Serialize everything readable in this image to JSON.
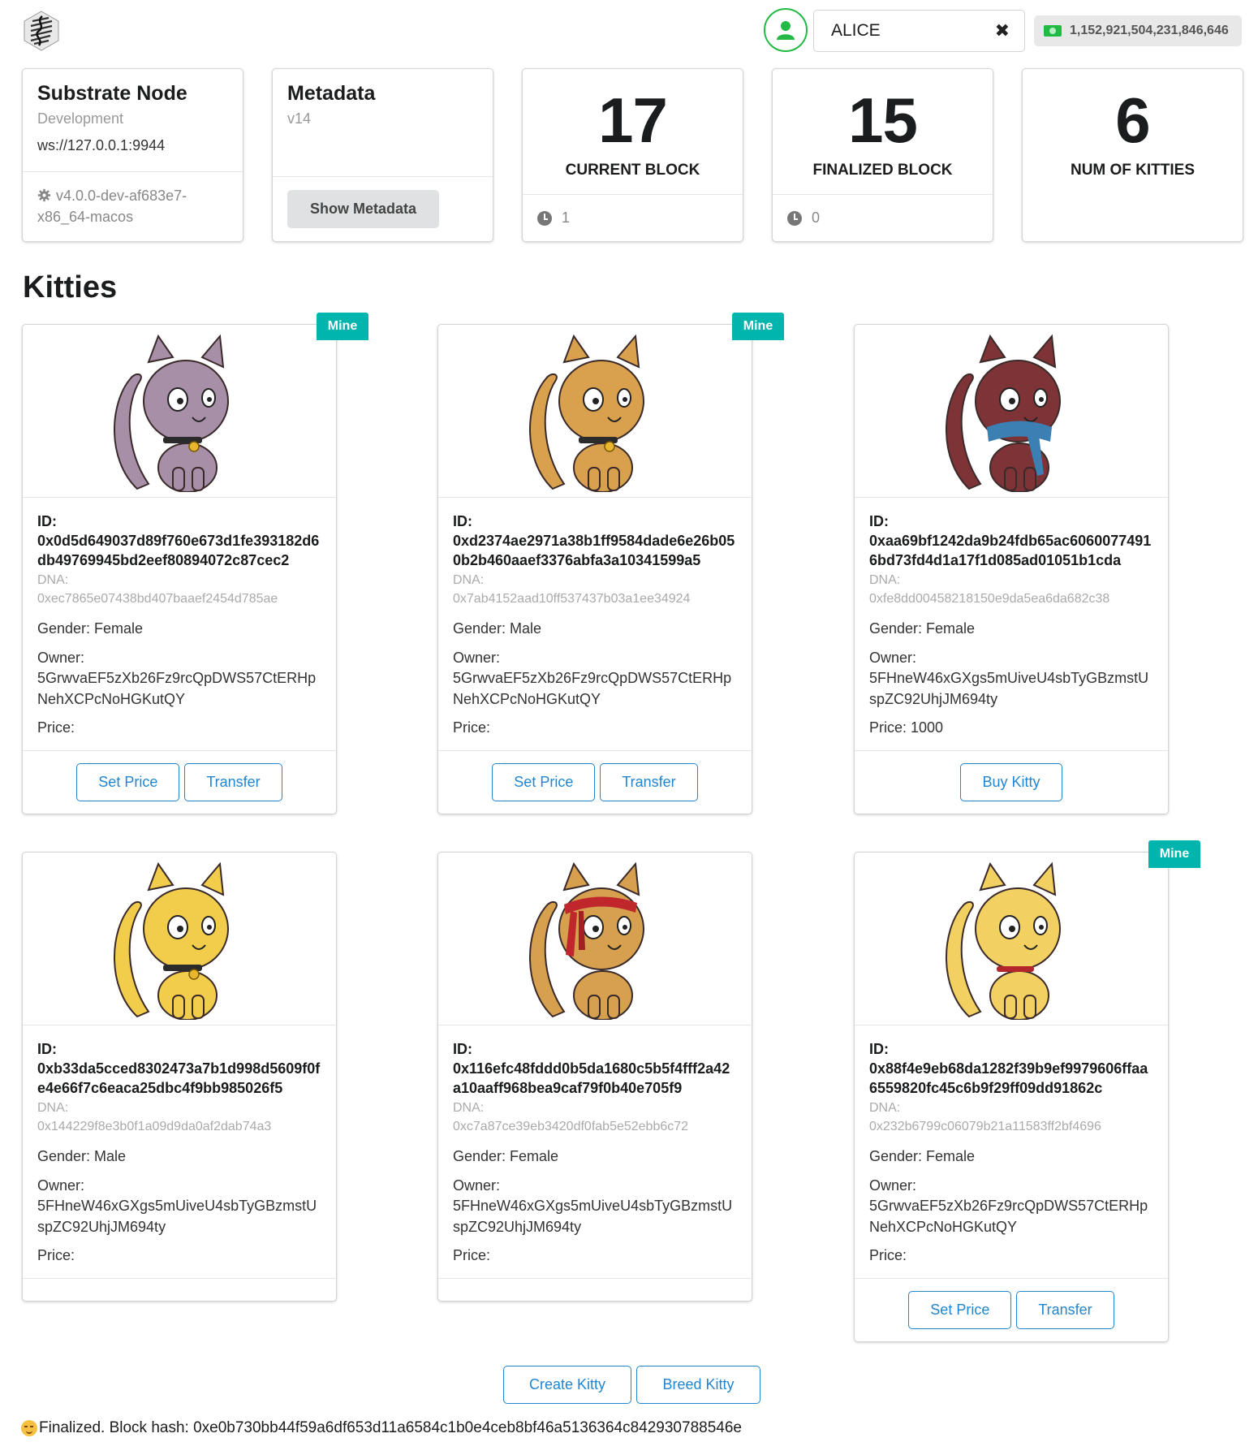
{
  "header": {
    "account_name": "ALICE",
    "clear_glyph": "✖",
    "balance": "1,152,921,504,231,846,646"
  },
  "stats": {
    "node": {
      "title": "Substrate Node",
      "chain": "Development",
      "socket": "ws://127.0.0.1:9944",
      "version": "v4.0.0-dev-af683e7-x86_64-macos"
    },
    "metadata": {
      "title": "Metadata",
      "version": "v14",
      "button_label": "Show Metadata"
    },
    "current_block": {
      "value": "17",
      "label": "CURRENT BLOCK",
      "timer": "1"
    },
    "finalized_block": {
      "value": "15",
      "label": "FINALIZED BLOCK",
      "timer": "0"
    },
    "num_kitties": {
      "value": "6",
      "label": "NUM OF KITTIES"
    }
  },
  "section_title": "Kitties",
  "labels": {
    "id": "ID:",
    "dna": "DNA:",
    "gender_prefix": "Gender: ",
    "owner": "Owner:",
    "price_prefix": "Price: ",
    "mine": "Mine",
    "set_price": "Set Price",
    "transfer": "Transfer",
    "buy": "Buy Kitty"
  },
  "kitties": [
    {
      "mine": true,
      "id": "0x0d5d649037d89f760e673d1fe393182d6db49769945bd2eef80894072c87cec2",
      "dna": "0xec7865e07438bd407baaef2454d785ae",
      "gender": "Female",
      "owner": "5GrwvaEF5zXb26Fz9rcQpDWS57CtERHpNehXCPcNoHGKutQY",
      "price": "",
      "actions": [
        "Set Price",
        "Transfer"
      ],
      "fur_color": "#a78fa8",
      "accessory": "collar"
    },
    {
      "mine": true,
      "id": "0xd2374ae2971a38b1ff9584dade6e26b050b2b460aaef3376abfa3a10341599a5",
      "dna": "0x7ab4152aad10ff537437b03a1ee34924",
      "gender": "Male",
      "owner": "5GrwvaEF5zXb26Fz9rcQpDWS57CtERHpNehXCPcNoHGKutQY",
      "price": "",
      "actions": [
        "Set Price",
        "Transfer"
      ],
      "fur_color": "#d9a14d",
      "accessory": "collar"
    },
    {
      "mine": false,
      "id": "0xaa69bf1242da9b24fdb65ac60600774916bd73fd4d1a17f1d085ad01051b1cda",
      "dna": "0xfe8dd00458218150e9da5ea6da682c38",
      "gender": "Female",
      "owner": "5FHneW46xGXgs5mUiveU4sbTyGBzmstUspZC92UhjJM694ty",
      "price": "1000",
      "actions": [
        "Buy Kitty"
      ],
      "fur_color": "#7e3336",
      "accessory": "scarf"
    },
    {
      "mine": false,
      "id": "0xb33da5cced8302473a7b1d998d5609f0fe4e66f7c6eaca25dbc4f9bb985026f5",
      "dna": "0x144229f8e3b0f1a09d9da0af2dab74a3",
      "gender": "Male",
      "owner": "5FHneW46xGXgs5mUiveU4sbTyGBzmstUspZC92UhjJM694ty",
      "price": "",
      "actions": [],
      "fur_color": "#f2cd4b",
      "accessory": "collar"
    },
    {
      "mine": false,
      "id": "0x116efc48fddd0b5da1680c5b5f4fff2a42a10aaff968bea9caf79f0b40e705f9",
      "dna": "0xc7a87ce39eb3420df0fab5e52ebb6c72",
      "gender": "Female",
      "owner": "5FHneW46xGXgs5mUiveU4sbTyGBzmstUspZC92UhjJM694ty",
      "price": "",
      "actions": [],
      "fur_color": "#d6a04e",
      "accessory": "headband"
    },
    {
      "mine": true,
      "id": "0x88f4e9eb68da1282f39b9ef9979606ffaa6559820fc45c6b9f29ff09dd91862c",
      "dna": "0x232b6799c06079b21a11583ff2bf4696",
      "gender": "Female",
      "owner": "5GrwvaEF5zXb26Fz9rcQpDWS57CtERHpNehXCPcNoHGKutQY",
      "price": "",
      "actions": [
        "Set Price",
        "Transfer"
      ],
      "fur_color": "#f2d061",
      "accessory": "red-collar"
    }
  ],
  "bottom": {
    "create_label": "Create Kitty",
    "breed_label": "Breed Kitty"
  },
  "status": {
    "text": "Finalized. Block hash: 0xe0b730bb44f59a6df653d11a6584c1b0e4ceb8bf46a5136364c842930788546e"
  }
}
